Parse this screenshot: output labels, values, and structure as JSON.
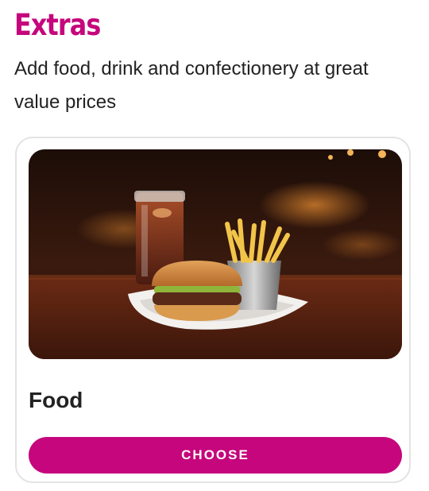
{
  "header": {
    "title": "Extras",
    "subtitle": "Add food, drink and confectionery at great value prices"
  },
  "card": {
    "title": "Food",
    "image_alt": "burger-fries-and-cola-photo",
    "button_label": "CHOOSE"
  },
  "colors": {
    "accent": "#c5067c",
    "text": "#222222",
    "card_border": "#e3e3e3"
  }
}
